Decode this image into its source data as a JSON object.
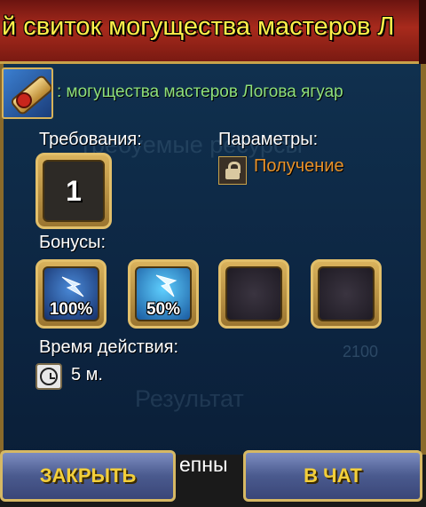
{
  "window": {
    "title": "й свиток могущества мастеров Л"
  },
  "item": {
    "name": ": могущества мастеров Логова ягуар",
    "icon": "scroll-icon"
  },
  "requirements": {
    "label": "Требования:",
    "level": "1"
  },
  "parameters": {
    "label": "Параметры:",
    "value": "Получение",
    "icon": "lock-icon"
  },
  "bonuses": {
    "label": "Бонусы:",
    "slots": [
      {
        "value": "100%",
        "icon": "lightning-icon"
      },
      {
        "value": "50%",
        "icon": "lightning-icon"
      },
      {
        "value": "",
        "icon": "empty-slot"
      },
      {
        "value": "",
        "icon": "empty-slot"
      }
    ]
  },
  "duration": {
    "label": "Время действия:",
    "value": "5 м.",
    "icon": "clock-icon"
  },
  "background": {
    "ghost_1": "Требуемые ресурсы",
    "ghost_2": "Результат",
    "ghost_number": "2100"
  },
  "footer": {
    "close_label": "ЗАКРЫТЬ",
    "middle_text": "епны",
    "chat_label": "В ЧАТ"
  },
  "colors": {
    "title_text": "#fff04a",
    "item_name": "#8fe07a",
    "param_value": "#e8922a",
    "button_text": "#f3cf3a",
    "gold_frame": "#d6b864"
  }
}
